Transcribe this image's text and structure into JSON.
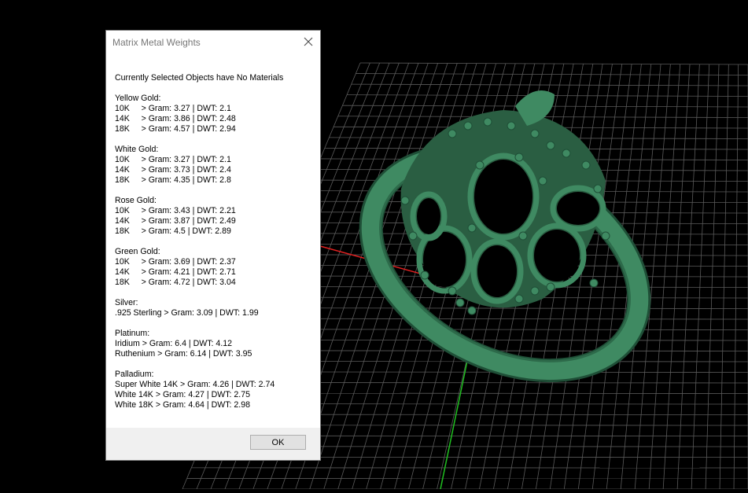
{
  "dialog": {
    "title": "Matrix Metal Weights",
    "header": "Currently Selected Objects have No Materials",
    "groups": [
      {
        "name": "Yellow Gold:",
        "rows": [
          "10K     > Gram: 3.27 | DWT: 2.1",
          "14K     > Gram: 3.86 | DWT: 2.48",
          "18K     > Gram: 4.57 | DWT: 2.94"
        ]
      },
      {
        "name": "White Gold:",
        "rows": [
          "10K     > Gram: 3.27 | DWT: 2.1",
          "14K     > Gram: 3.73 | DWT: 2.4",
          "18K     > Gram: 4.35 | DWT: 2.8"
        ]
      },
      {
        "name": "Rose Gold:",
        "rows": [
          "10K     > Gram: 3.43 | DWT: 2.21",
          "14K     > Gram: 3.87 | DWT: 2.49",
          "18K     > Gram: 4.5 | DWT: 2.89"
        ]
      },
      {
        "name": "Green Gold:",
        "rows": [
          "10K     > Gram: 3.69 | DWT: 2.37",
          "14K     > Gram: 4.21 | DWT: 2.71",
          "18K     > Gram: 4.72 | DWT: 3.04"
        ]
      },
      {
        "name": "Silver:",
        "rows": [
          ".925 Sterling > Gram: 3.09 | DWT: 1.99"
        ]
      },
      {
        "name": "Platinum:",
        "rows": [
          "Iridium > Gram: 6.4 | DWT: 4.12",
          "Ruthenium > Gram: 6.14 | DWT: 3.95"
        ]
      },
      {
        "name": "Palladium:",
        "rows": [
          "Super White 14K > Gram: 4.26 | DWT: 2.74",
          "White 14K > Gram: 4.27 | DWT: 2.75",
          "White 18K > Gram: 4.64 | DWT: 2.98"
        ]
      }
    ],
    "ok_label": "OK"
  },
  "viewport": {
    "background": "#000000",
    "grid_color": "#5a5a5a",
    "x_axis_color": "#e02020",
    "y_axis_color": "#20c020",
    "ring_color": "#3f8a62",
    "ring_shadow": "#1f4f37"
  }
}
